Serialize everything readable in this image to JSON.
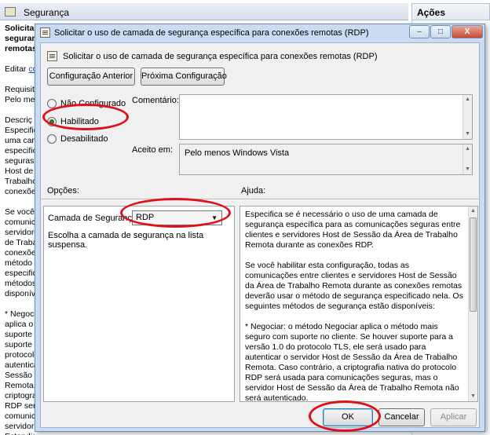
{
  "background_window": {
    "title": "Segurança",
    "actions_label": "Ações",
    "side_lines": [
      {
        "text": "Solicitar",
        "bold": true
      },
      {
        "text": "seguranç",
        "bold": true
      },
      {
        "text": "remotas",
        "bold": true
      },
      {
        "text": ""
      },
      {
        "text": "Editar ",
        "link": "co"
      },
      {
        "text": ""
      },
      {
        "text": "Requisito"
      },
      {
        "text": "Pelo men"
      },
      {
        "text": ""
      },
      {
        "text": "Descriç"
      },
      {
        "text": "Especific"
      },
      {
        "text": "uma can"
      },
      {
        "text": "especific"
      },
      {
        "text": "seguras e"
      },
      {
        "text": "Host de"
      },
      {
        "text": "Trabalho"
      },
      {
        "text": "conexões"
      },
      {
        "text": ""
      },
      {
        "text": "Se você"
      },
      {
        "text": "comunic"
      },
      {
        "text": "servidore"
      },
      {
        "text": "de Trabal"
      },
      {
        "text": "conexões"
      },
      {
        "text": "método"
      },
      {
        "text": "especific"
      },
      {
        "text": "métodos"
      },
      {
        "text": "disponív"
      },
      {
        "text": ""
      },
      {
        "text": "* Negoci"
      },
      {
        "text": "aplica o"
      },
      {
        "text": "suporte"
      },
      {
        "text": "suporte p"
      },
      {
        "text": "protocolo"
      },
      {
        "text": "autentica"
      },
      {
        "text": "Sessão d"
      },
      {
        "text": "Remota."
      },
      {
        "text": "criptogra"
      },
      {
        "text": "RDP será"
      },
      {
        "text": "comunic"
      },
      {
        "text": "servidor"
      },
      {
        "text": "Estendid"
      }
    ]
  },
  "dialog": {
    "title": "Solicitar o uso de camada de segurança específica para conexões remotas (RDP)",
    "window_buttons": {
      "minimize": "–",
      "maximize": "□",
      "close": "X"
    },
    "setting_title": "Solicitar o uso de camada de segurança específica para conexões remotas (RDP)",
    "prev_button": "Configuração Anterior",
    "next_button": "Próxima Configuração",
    "radio_options": [
      {
        "label": "Não Configurado",
        "checked": false
      },
      {
        "label": "Habilitado",
        "checked": true
      },
      {
        "label": "Desabilitado",
        "checked": false
      }
    ],
    "comment_label": "Comentário:",
    "comment_value": "",
    "supported_label": "Aceito em:",
    "supported_value": "Pelo menos Windows Vista",
    "options_label": "Opções:",
    "help_label": "Ajuda:",
    "options": {
      "security_layer_label": "Camada de Segurança",
      "security_layer_value": "RDP",
      "instruction": "Escolha a camada de segurança na lista suspensa."
    },
    "help_paragraphs": [
      "Especifica se é necessário o uso de uma camada de segurança específica para as comunicações seguras entre clientes e servidores Host de Sessão da Área de Trabalho Remota durante as conexões RDP.",
      "Se você habilitar esta configuração, todas as comunicações entre clientes e servidores Host de Sessão da Área de Trabalho Remota durante as conexões remotas deverão usar o método de segurança especificado nela. Os seguintes métodos de segurança estão disponíveis:",
      "* Negociar: o método Negociar aplica o método mais seguro com suporte no cliente. Se houver suporte para a versão 1.0 do protocolo TLS, ele será usado para autenticar o servidor Host de Sessão da Área de Trabalho Remota. Caso contrário, a criptografia nativa do protocolo RDP será usada para comunicações seguras, mas o servidor Host de Sessão da Área de Trabalho Remota não será autenticado."
    ],
    "ok_button": "OK",
    "cancel_button": "Cancelar",
    "apply_button": "Aplicar"
  },
  "colors": {
    "annotation": "#e0101a",
    "dialog_frame": "#c9dcf2",
    "radio_checked": "#2a7a1f"
  },
  "icons": {
    "dialog_title_icon": "policy-setting-icon",
    "dropdown_arrow": "chevron-down-icon"
  }
}
